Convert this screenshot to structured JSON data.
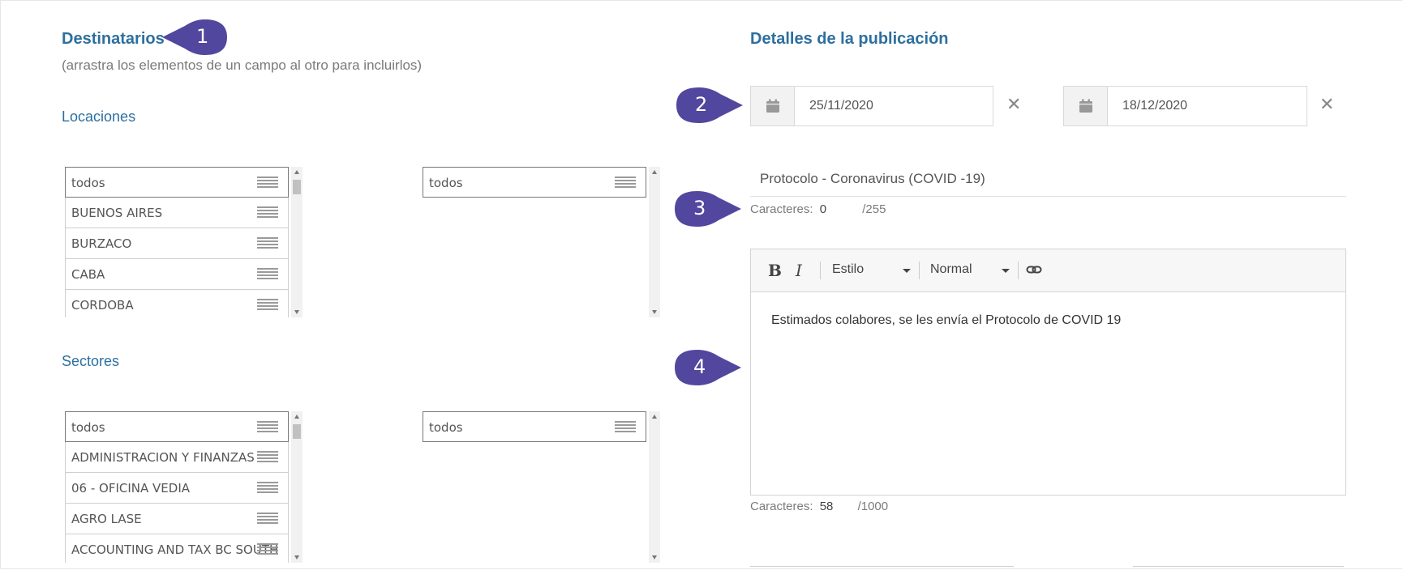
{
  "recipients": {
    "title": "Destinatarios",
    "hint": "(arrastra los elementos de un campo al otro para incluirlos)",
    "locations": {
      "label": "Locaciones",
      "available": [
        "todos",
        "BUENOS AIRES",
        "BURZACO",
        "CABA",
        "CORDOBA"
      ],
      "selected": [
        "todos"
      ]
    },
    "sectors": {
      "label": "Sectores",
      "available": [
        "todos",
        "ADMINISTRACION Y FINANZAS",
        "06 - OFICINA VEDIA",
        "AGRO LASE",
        "ACCOUNTING AND TAX BC SOUTH"
      ],
      "selected": [
        "todos"
      ]
    }
  },
  "publication": {
    "title": "Detalles de la publicación",
    "start_date": "25/11/2020",
    "end_date": "18/12/2020",
    "headline": "Protocolo - Coronavirus (COVID -19)",
    "headline_counter": {
      "label": "Caracteres:",
      "count": "0",
      "max": "/255"
    },
    "editor": {
      "style_label": "Estilo",
      "size_label": "Normal",
      "body": "Estimados colabores, se les envía el Protocolo de COVID 19"
    },
    "body_counter": {
      "label": "Caracteres:",
      "count": "58",
      "max": "/1000"
    }
  },
  "callouts": [
    "1",
    "2",
    "3",
    "4"
  ],
  "colors": {
    "heading": "#2d6f9f",
    "callout": "#52479e"
  }
}
